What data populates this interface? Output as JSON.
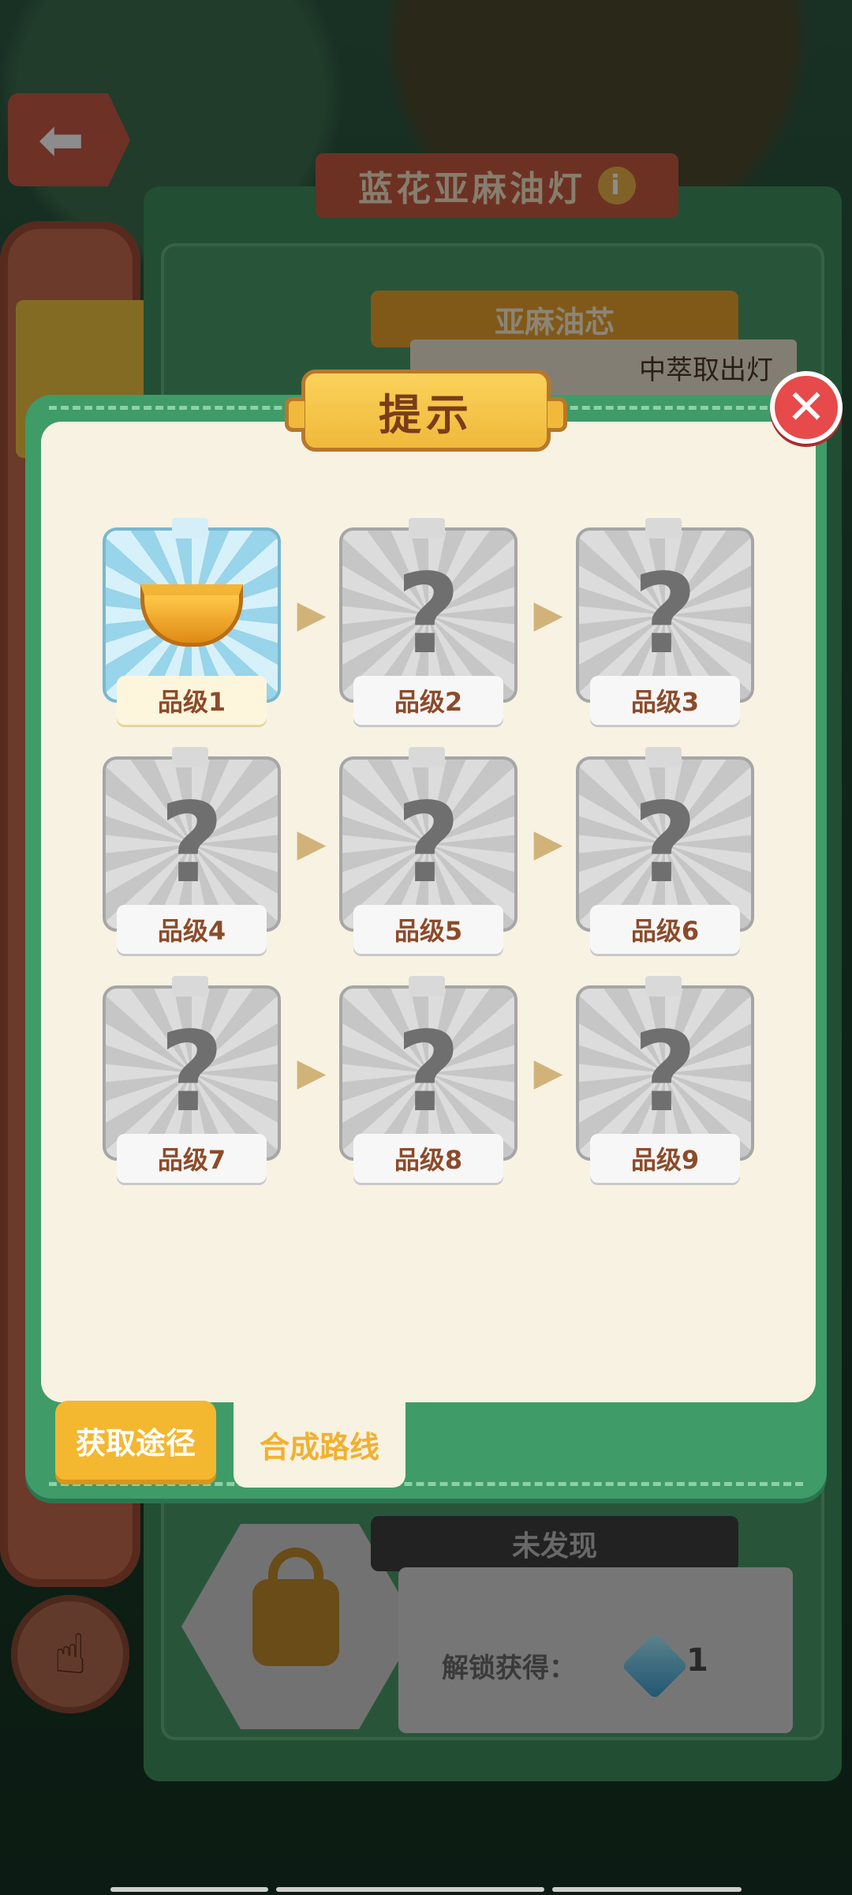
{
  "background": {
    "title": "蓝花亚麻油灯",
    "subtitle": "亚麻油芯",
    "description": "中萃取出灯",
    "undiscovered": "未发现",
    "unlock_reward_label": "解锁获得：",
    "gem_count": "1"
  },
  "modal": {
    "title": "提示",
    "tiers": [
      {
        "label": "品级1",
        "unlocked": true,
        "icon": "oil-bowl-icon"
      },
      {
        "label": "品级2",
        "unlocked": false,
        "icon": "question-mark-icon"
      },
      {
        "label": "品级3",
        "unlocked": false,
        "icon": "question-mark-icon"
      },
      {
        "label": "品级4",
        "unlocked": false,
        "icon": "question-mark-icon"
      },
      {
        "label": "品级5",
        "unlocked": false,
        "icon": "question-mark-icon"
      },
      {
        "label": "品级6",
        "unlocked": false,
        "icon": "question-mark-icon"
      },
      {
        "label": "品级7",
        "unlocked": false,
        "icon": "question-mark-icon"
      },
      {
        "label": "品级8",
        "unlocked": false,
        "icon": "question-mark-icon"
      },
      {
        "label": "品级9",
        "unlocked": false,
        "icon": "question-mark-icon"
      }
    ],
    "tabs": {
      "get_method": "获取途径",
      "craft_route": "合成路线",
      "active": "craft_route"
    }
  },
  "colors": {
    "modal_green": "#3f9b68",
    "modal_cream": "#f8f2e2",
    "title_yellow": "#f0b93b",
    "close_red": "#e74a4a",
    "label_brown": "#8c4b2a"
  }
}
